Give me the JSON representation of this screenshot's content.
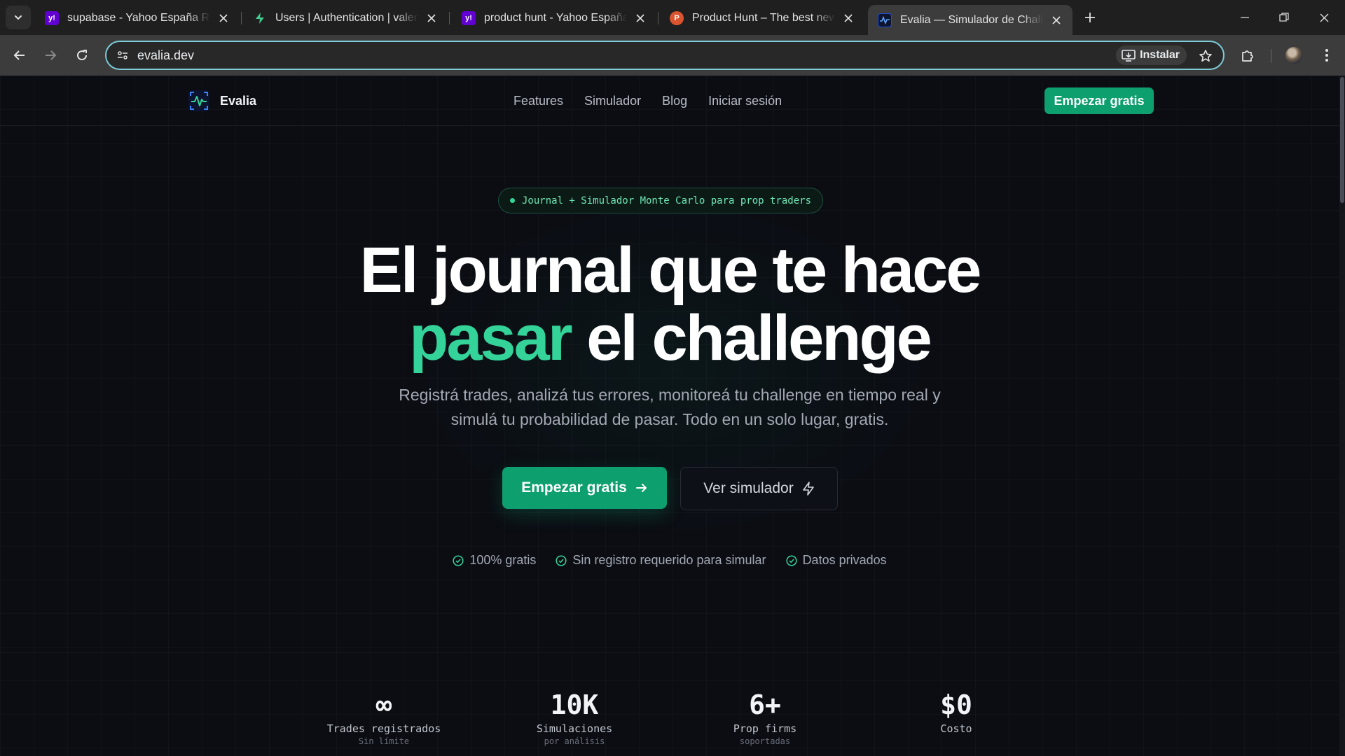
{
  "browser": {
    "tabs": [
      {
        "title": "supabase - Yahoo España Resultados",
        "favicon": "yahoo-icon",
        "favicon_color": "#6001d2"
      },
      {
        "title": "Users | Authentication | valenab",
        "favicon": "supabase-icon",
        "favicon_color": "#3ecf8e"
      },
      {
        "title": "product hunt - Yahoo España Resultados",
        "favicon": "yahoo-icon",
        "favicon_color": "#6001d2"
      },
      {
        "title": "Product Hunt – The best new products",
        "favicon": "producthunt-icon",
        "favicon_color": "#da552f"
      },
      {
        "title": "Evalia — Simulador de Challenge",
        "favicon": "evalia-icon",
        "favicon_color": "#1d4ed8",
        "active": true
      }
    ],
    "address": "evalia.dev",
    "install_label": "Instalar"
  },
  "site": {
    "brand": "Evalia",
    "nav": [
      "Features",
      "Simulador",
      "Blog",
      "Iniciar sesión"
    ],
    "nav_cta": "Empezar gratis"
  },
  "hero": {
    "badge": "Journal + Simulador Monte Carlo para prop traders",
    "headline_line1": "El journal que te hace",
    "headline_accent": "pasar",
    "headline_line2_rest": "el challenge",
    "subtitle_line1": "Registrá trades, analizá tus errores, monitoreá tu challenge en tiempo real y",
    "subtitle_line2": "simulá tu probabilidad de pasar. Todo en un solo lugar, gratis.",
    "cta_primary": "Empezar gratis",
    "cta_secondary": "Ver simulador",
    "checks": [
      "100% gratis",
      "Sin registro requerido para simular",
      "Datos privados"
    ]
  },
  "stats": [
    {
      "value": "∞",
      "label": "Trades registrados",
      "sub": "Sin límite"
    },
    {
      "value": "10K",
      "label": "Simulaciones",
      "sub": "por análisis"
    },
    {
      "value": "6+",
      "label": "Prop firms",
      "sub": "soportadas"
    },
    {
      "value": "$0",
      "label": "Costo",
      "sub": ""
    }
  ],
  "colors": {
    "accent": "#34d399",
    "primary_button": "#0e9f6e",
    "background": "#0b0d13"
  }
}
